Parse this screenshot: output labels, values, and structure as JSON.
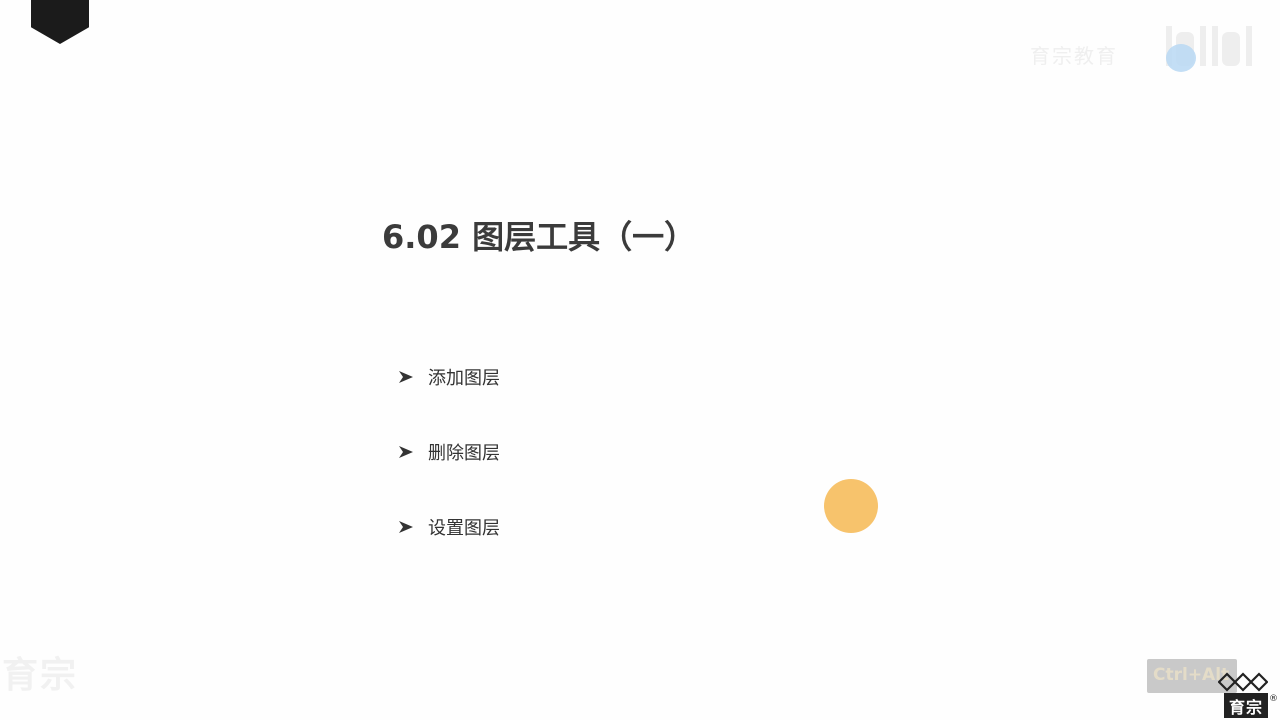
{
  "slide": {
    "title": "6.02 图层工具（一）",
    "bullets": [
      {
        "label": "添加图层"
      },
      {
        "label": "删除图层"
      },
      {
        "label": "设置图层"
      }
    ]
  },
  "watermarks": {
    "top_right_text": "育宗教育",
    "bottom_left_text": "育宗"
  },
  "page_indicator": {
    "text": "Ctrl+Alt"
  },
  "brand": {
    "logo_text": "育宗",
    "registered_mark": "®"
  },
  "icons": {
    "bullet": "arrowhead-bullet-icon",
    "cursor": "cursor-highlight-icon"
  },
  "colors": {
    "background": "#fefefe",
    "title": "#3b3b3b",
    "cursor_highlight": "#f7c36c",
    "badge": "#1b1b1b"
  }
}
